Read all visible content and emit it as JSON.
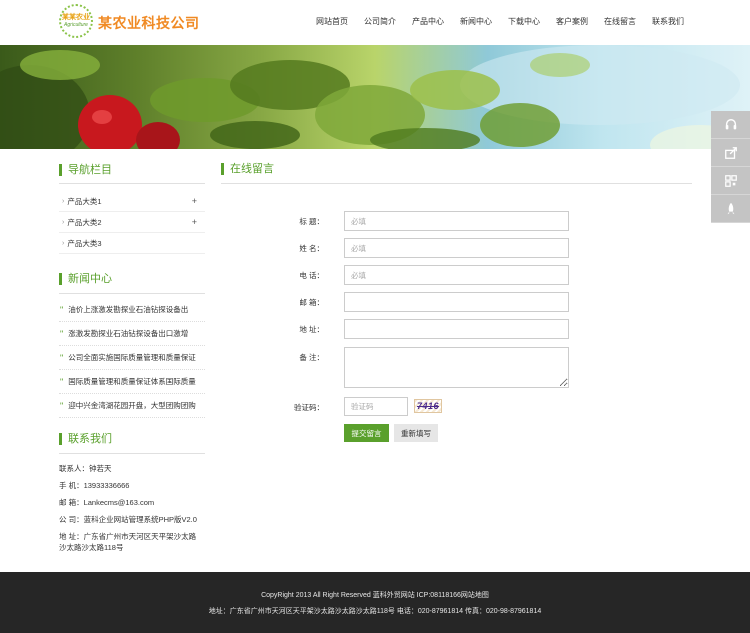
{
  "header": {
    "logo_line1": "某某农业",
    "logo_line2": "Agriculture",
    "company": "某农业科技公司",
    "nav": [
      "网站首页",
      "公司简介",
      "产品中心",
      "新闻中心",
      "下载中心",
      "客户案例",
      "在线留言",
      "联系我们"
    ]
  },
  "sidebar": {
    "nav_title": "导航栏目",
    "categories": [
      {
        "label": "产品大类1",
        "expand": "+"
      },
      {
        "label": "产品大类2",
        "expand": "+"
      },
      {
        "label": "产品大类3",
        "expand": ""
      }
    ],
    "news_title": "新闻中心",
    "news": [
      "油价上涨激发勘探业石油钻探设备出",
      "涨激发勘探业石油钻探设备出口激增",
      "公司全面实施国际质量管理和质量保证",
      "国际质量管理和质量保证体系国际质量",
      "迎中兴金湾湖花园开盘，大型团购团购"
    ],
    "contact_title": "联系我们",
    "contact": {
      "person": "联系人：钟若天",
      "mobile": "手 机：13933336666",
      "email": "邮 箱：Lankecms@163.com",
      "company": "公 司：蓝科企业网站管理系统PHP版V2.0",
      "address1": "地 址：广东省广州市天河区天平架沙太路",
      "address2": "沙太路沙太路118号"
    }
  },
  "main": {
    "title": "在线留言",
    "form": {
      "title_label": "标 题：",
      "title_placeholder": "必填",
      "name_label": "姓 名：",
      "name_placeholder": "必填",
      "phone_label": "电 话：",
      "phone_placeholder": "必填",
      "email_label": "邮 箱：",
      "address_label": "地 址：",
      "remark_label": "备 注：",
      "captcha_label": "验证码：",
      "captcha_placeholder": "验证码",
      "captcha_text": "7416",
      "submit": "提交留言",
      "reset": "重新填写"
    }
  },
  "footer": {
    "line1": "CopyRight 2013 All Right Reserved 蓝科外贸网站 ICP:08118166网站地图",
    "line2": "地址：广东省广州市天河区天平架沙太路沙太路沙太路118号  电话：020-87961814  传真：020-98-87961814"
  },
  "colors": {
    "accent": "#5aa02c",
    "brand": "#f08a24",
    "footer_bg": "#262626"
  },
  "float_tools": [
    "headset-icon",
    "share-icon",
    "qrcode-icon",
    "rocket-icon"
  ]
}
